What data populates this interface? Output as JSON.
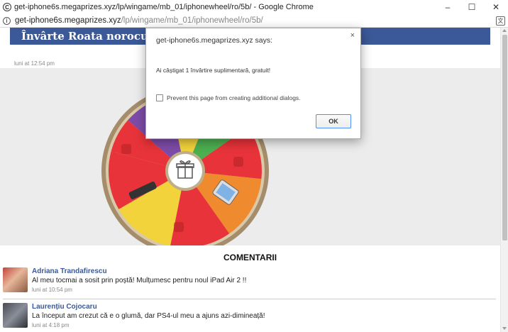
{
  "window": {
    "title": "get-iphone6s.megaprizes.xyz/lp/wingame/mb_01/iphonewheel/ro/5b/ - Google Chrome",
    "controls": {
      "minimize": "–",
      "maximize": "☐",
      "close": "✕"
    }
  },
  "addressbar": {
    "host": "get-iphone6s.megaprizes.xyz",
    "path": "/lp/wingame/mb_01/iphonewheel/ro/5b/"
  },
  "page": {
    "header_title": "Învârte Roata norocului!",
    "post_time": "luni at 12:54 pm",
    "comments_title": "COMENTARII",
    "comments": [
      {
        "name": "Adriana Trandafirescu",
        "text": "Al meu tocmai a sosit prin poștă! Mulțumesc pentru noul iPad Air 2 !!",
        "time": "luni at 10:54 pm"
      },
      {
        "name": "Laurențiu Cojocaru",
        "text": "La început am crezut că e o glumă, dar PS4-ul meu a ajuns azi-dimineață!",
        "time": "luni at 4:18 pm"
      }
    ]
  },
  "dialog": {
    "title": "get-iphone6s.megaprizes.xyz says:",
    "message": "Ai câștigat 1 învârtire suplimentară, gratuit!",
    "checkbox_label": "Prevent this page from creating additional dialogs.",
    "ok_label": "OK",
    "close": "×"
  },
  "colors": {
    "fb_blue": "#3b5998",
    "wheel_red": "#e8333a",
    "wheel_yellow": "#f3d33c",
    "wheel_orange": "#f08a2e",
    "wheel_purple": "#7e4ca8",
    "wheel_green": "#4caf50",
    "wheel_rim": "#a58d6b"
  }
}
